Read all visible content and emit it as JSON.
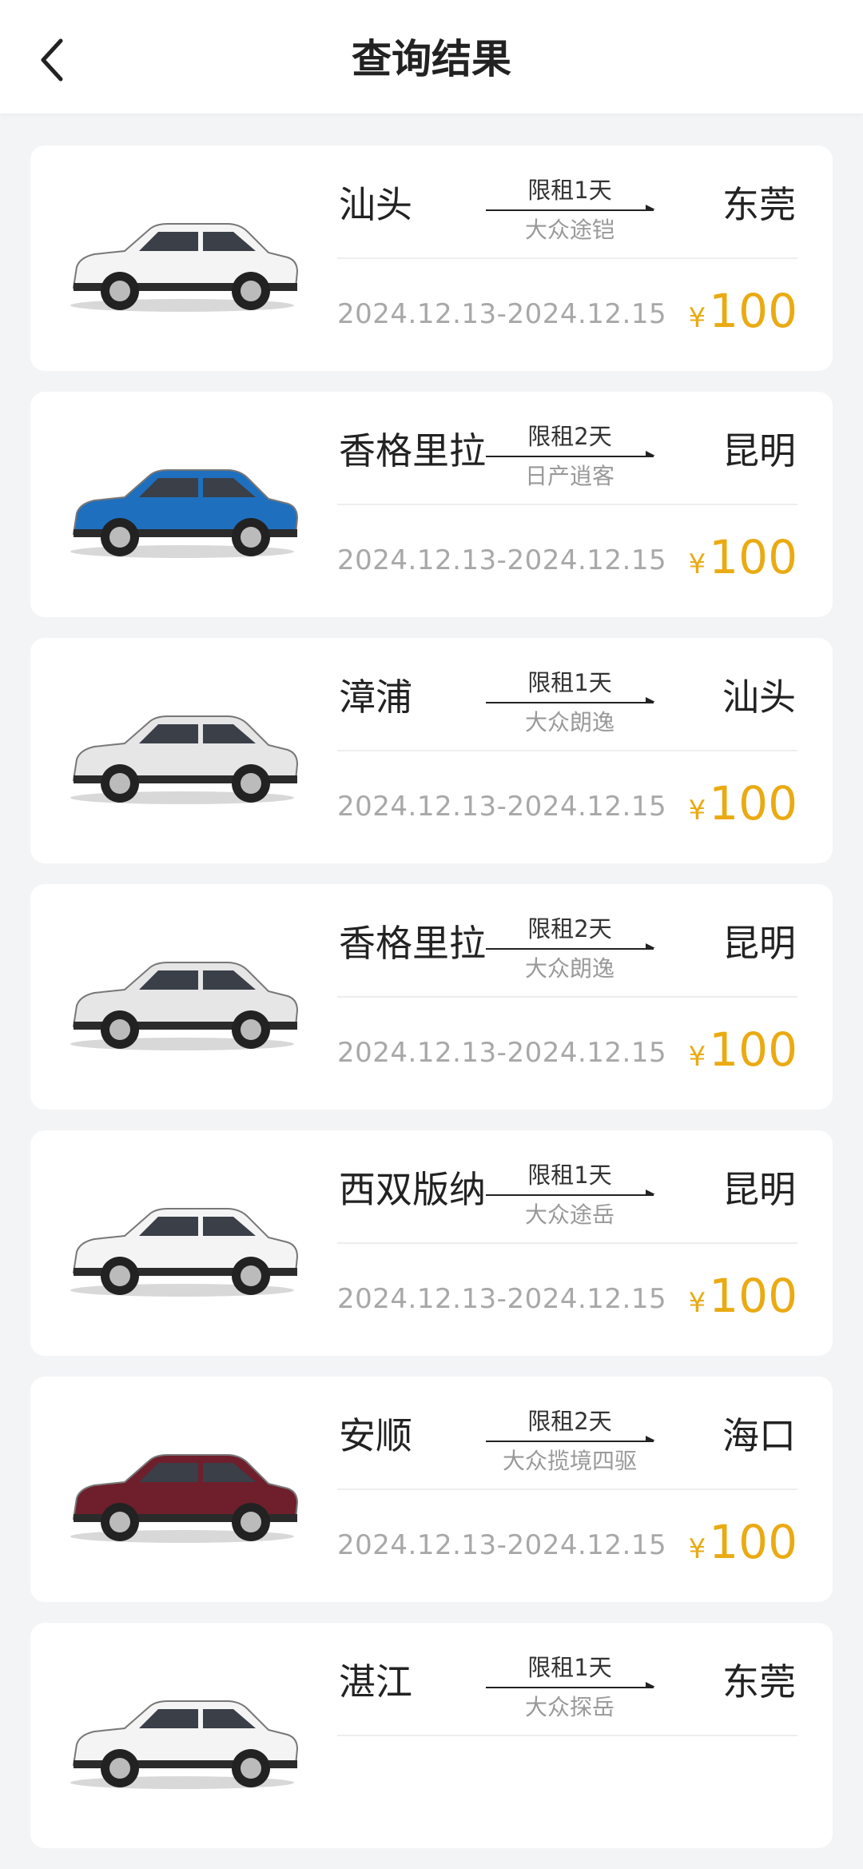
{
  "header": {
    "title": "查询结果"
  },
  "colors": {
    "price": "#eaaa12",
    "background": "#f3f4f6"
  },
  "results": [
    {
      "from": "汕头",
      "to": "东莞",
      "limit": "限租1天",
      "model": "大众途铠",
      "dates": "2024.12.13-2024.12.15",
      "currency": "¥",
      "price": "100",
      "car_color": "#f4f4f4"
    },
    {
      "from": "香格里拉",
      "to": "昆明",
      "limit": "限租2天",
      "model": "日产逍客",
      "dates": "2024.12.13-2024.12.15",
      "currency": "¥",
      "price": "100",
      "car_color": "#1f6fbf"
    },
    {
      "from": "漳浦",
      "to": "汕头",
      "limit": "限租1天",
      "model": "大众朗逸",
      "dates": "2024.12.13-2024.12.15",
      "currency": "¥",
      "price": "100",
      "car_color": "#e6e6e6"
    },
    {
      "from": "香格里拉",
      "to": "昆明",
      "limit": "限租2天",
      "model": "大众朗逸",
      "dates": "2024.12.13-2024.12.15",
      "currency": "¥",
      "price": "100",
      "car_color": "#e6e6e6"
    },
    {
      "from": "西双版纳",
      "to": "昆明",
      "limit": "限租1天",
      "model": "大众途岳",
      "dates": "2024.12.13-2024.12.15",
      "currency": "¥",
      "price": "100",
      "car_color": "#f4f4f4"
    },
    {
      "from": "安顺",
      "to": "海口",
      "limit": "限租2天",
      "model": "大众揽境四驱",
      "dates": "2024.12.13-2024.12.15",
      "currency": "¥",
      "price": "100",
      "car_color": "#6e1f2b"
    },
    {
      "from": "湛江",
      "to": "东莞",
      "limit": "限租1天",
      "model": "大众探岳",
      "dates": "",
      "currency": "",
      "price": "",
      "car_color": "#f4f4f4"
    }
  ]
}
